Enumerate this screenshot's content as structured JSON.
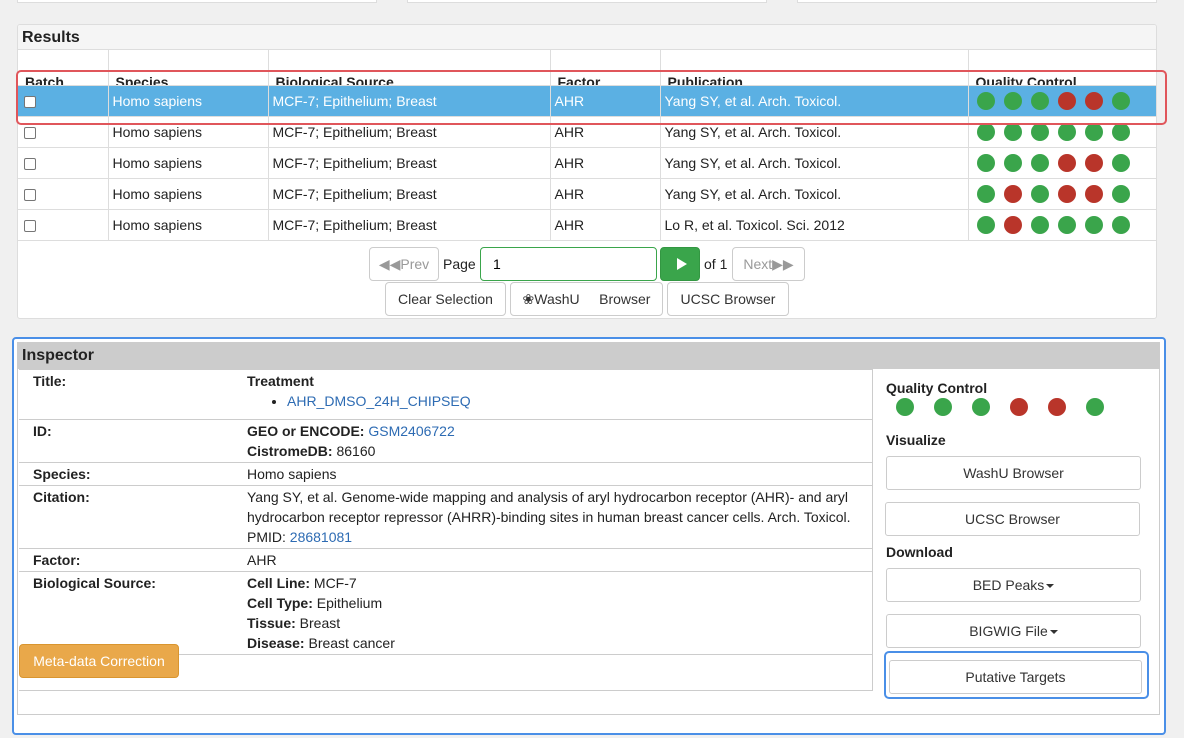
{
  "results": {
    "title": "Results",
    "columns": [
      "Batch",
      "Species",
      "Biological Source",
      "Factor",
      "Publication",
      "Quality Control"
    ],
    "rows": [
      {
        "species": "Homo sapiens",
        "source": "MCF-7; Epithelium; Breast",
        "factor": "AHR",
        "publication": "Yang SY, et al. Arch. Toxicol.",
        "qc": [
          "pass",
          "pass",
          "pass",
          "fail",
          "fail",
          "pass"
        ],
        "selected": true
      },
      {
        "species": "Homo sapiens",
        "source": "MCF-7; Epithelium; Breast",
        "factor": "AHR",
        "publication": "Yang SY, et al. Arch. Toxicol.",
        "qc": [
          "pass",
          "pass",
          "pass",
          "pass",
          "pass",
          "pass"
        ],
        "selected": false
      },
      {
        "species": "Homo sapiens",
        "source": "MCF-7; Epithelium; Breast",
        "factor": "AHR",
        "publication": "Yang SY, et al. Arch. Toxicol.",
        "qc": [
          "pass",
          "pass",
          "pass",
          "fail",
          "fail",
          "pass"
        ],
        "selected": false
      },
      {
        "species": "Homo sapiens",
        "source": "MCF-7; Epithelium; Breast",
        "factor": "AHR",
        "publication": "Yang SY, et al. Arch. Toxicol.",
        "qc": [
          "pass",
          "fail",
          "pass",
          "fail",
          "fail",
          "pass"
        ],
        "selected": false
      },
      {
        "species": "Homo sapiens",
        "source": "MCF-7; Epithelium; Breast",
        "factor": "AHR",
        "publication": "Lo R, et al. Toxicol. Sci. 2012",
        "qc": [
          "pass",
          "fail",
          "pass",
          "pass",
          "pass",
          "pass"
        ],
        "selected": false
      }
    ],
    "colors": {
      "pass": "#3aa54b",
      "fail": "#b9352a",
      "selected_row": "#5bb0e3"
    }
  },
  "pagination": {
    "prev_label": "Prev",
    "page_label": "Page",
    "page_value": "1",
    "of_label": "of 1",
    "next_label": "Next"
  },
  "actions": {
    "clear_selection": "Clear Selection",
    "washu_label": "WashU",
    "washu_suffix": "Browser",
    "ucsc_label": "UCSC Browser"
  },
  "inspector": {
    "title": "Inspector",
    "labels": {
      "title": "Title:",
      "id": "ID:",
      "species": "Species:",
      "citation": "Citation:",
      "factor": "Factor:",
      "bio_source": "Biological Source:"
    },
    "treatment_label": "Treatment",
    "treatment_item": "AHR_DMSO_24H_CHIPSEQ",
    "geo_label": "GEO or ENCODE:",
    "geo_value": "GSM2406722",
    "cistrome_label": "CistromeDB:",
    "cistrome_value": "86160",
    "species_value": "Homo sapiens",
    "citation_text": "Yang SY, et al. Genome-wide mapping and analysis of aryl hydrocarbon receptor (AHR)- and aryl hydrocarbon receptor repressor (AHRR)-binding sites in human breast cancer cells. Arch. Toxicol.",
    "pmid_label": "PMID:",
    "pmid_value": "28681081",
    "factor_value": "AHR",
    "cell_line_label": "Cell Line:",
    "cell_line_value": "MCF-7",
    "cell_type_label": "Cell Type:",
    "cell_type_value": "Epithelium",
    "tissue_label": "Tissue:",
    "tissue_value": "Breast",
    "disease_label": "Disease:",
    "disease_value": "Breast cancer",
    "metadata_button": "Meta-data Correction",
    "qc_heading": "Quality Control",
    "qc": [
      "pass",
      "pass",
      "pass",
      "fail",
      "fail",
      "pass"
    ],
    "visualize_heading": "Visualize",
    "washu_button": "WashU Browser",
    "ucsc_button": "UCSC Browser",
    "download_heading": "Download",
    "bed_button": "BED Peaks",
    "bigwig_button": "BIGWIG File",
    "targets_button": "Putative Targets"
  },
  "icons": {
    "prev": "chevron-double-left-icon",
    "next": "chevron-double-right-icon",
    "go": "play-icon",
    "washu": "leaf-icon",
    "caret": "caret-down-icon"
  }
}
